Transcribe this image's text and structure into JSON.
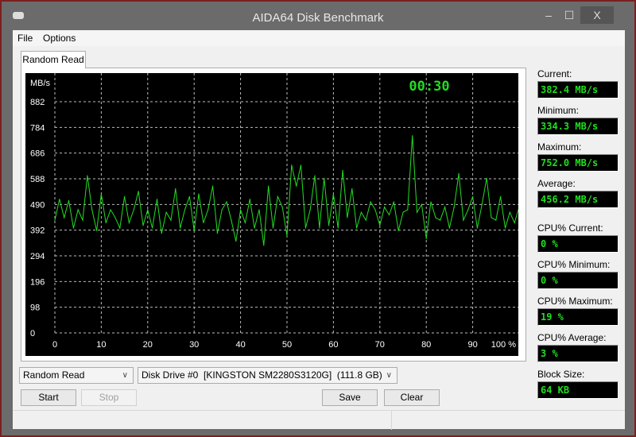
{
  "window": {
    "title": "AIDA64 Disk Benchmark",
    "minimize": "–",
    "maximize": "☐",
    "close": "X",
    "app_icon": "disk-drive-icon"
  },
  "menu": {
    "items": [
      "File",
      "Options"
    ]
  },
  "tab": {
    "label": "Random Read"
  },
  "stats": [
    {
      "label": "Current:",
      "value": "382.4 MB/s"
    },
    {
      "label": "Minimum:",
      "value": "334.3 MB/s"
    },
    {
      "label": "Maximum:",
      "value": "752.0 MB/s"
    },
    {
      "label": "Average:",
      "value": "456.2 MB/s"
    },
    {
      "label": "CPU% Current:",
      "value": "0 %"
    },
    {
      "label": "CPU% Minimum:",
      "value": "0 %"
    },
    {
      "label": "CPU% Maximum:",
      "value": "19 %"
    },
    {
      "label": "CPU% Average:",
      "value": "3 %"
    },
    {
      "label": "Block Size:",
      "value": "64 KB"
    }
  ],
  "controls": {
    "test_select": "Random Read",
    "drive_select": "Disk Drive #0  [KINGSTON SM2280S3120G]  (111.8 GB)",
    "start": "Start",
    "stop": "Stop",
    "save": "Save",
    "clear": "Clear"
  },
  "chart_data": {
    "type": "line",
    "timer": "00:30",
    "ylabel": "MB/s",
    "ylim": [
      0,
      882
    ],
    "xlim": [
      0,
      100
    ],
    "yticks": [
      "0",
      "98",
      "196",
      "294",
      "392",
      "490",
      "588",
      "686",
      "784",
      "882"
    ],
    "xticks": [
      "0",
      "10",
      "20",
      "30",
      "40",
      "50",
      "60",
      "70",
      "80",
      "90",
      "100 %"
    ],
    "grid": true,
    "line_color": "#22dd22",
    "x": [
      0,
      1,
      2,
      3,
      4,
      5,
      6,
      7,
      8,
      9,
      10,
      11,
      12,
      13,
      14,
      15,
      16,
      17,
      18,
      19,
      20,
      21,
      22,
      23,
      24,
      25,
      26,
      27,
      28,
      29,
      30,
      31,
      32,
      33,
      34,
      35,
      36,
      37,
      38,
      39,
      40,
      41,
      42,
      43,
      44,
      45,
      46,
      47,
      48,
      49,
      50,
      51,
      52,
      53,
      54,
      55,
      56,
      57,
      58,
      59,
      60,
      61,
      62,
      63,
      64,
      65,
      66,
      67,
      68,
      69,
      70,
      71,
      72,
      73,
      74,
      75,
      76,
      77,
      78,
      79,
      80,
      81,
      82,
      83,
      84,
      85,
      86,
      87,
      88,
      89,
      90,
      91,
      92,
      93,
      94,
      95,
      96,
      97,
      98,
      99,
      100
    ],
    "y": [
      430,
      510,
      440,
      505,
      400,
      470,
      430,
      600,
      470,
      390,
      530,
      420,
      470,
      440,
      400,
      520,
      420,
      470,
      540,
      410,
      470,
      400,
      510,
      380,
      460,
      430,
      550,
      400,
      470,
      520,
      390,
      530,
      420,
      470,
      560,
      380,
      470,
      500,
      430,
      350,
      470,
      420,
      510,
      400,
      470,
      334,
      560,
      400,
      520,
      480,
      370,
      640,
      560,
      640,
      400,
      470,
      600,
      400,
      590,
      410,
      530,
      400,
      620,
      440,
      550,
      400,
      460,
      430,
      500,
      470,
      410,
      480,
      450,
      500,
      390,
      460,
      470,
      752,
      460,
      490,
      360,
      500,
      440,
      430,
      480,
      400,
      480,
      608,
      430,
      470,
      520,
      400,
      490,
      590,
      440,
      430,
      520,
      400,
      460,
      420,
      480
    ]
  }
}
